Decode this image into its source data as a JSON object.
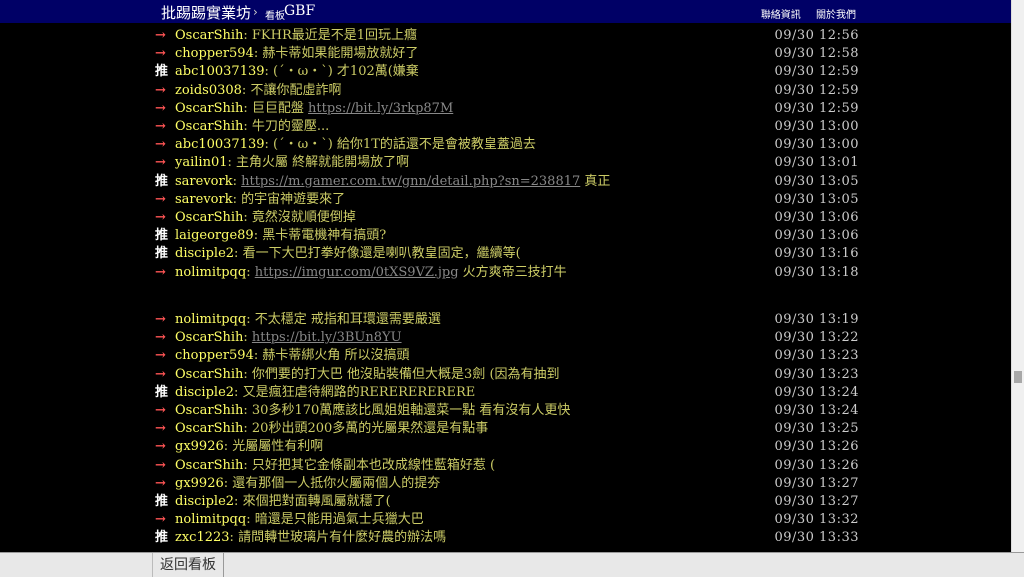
{
  "header": {
    "site_title": "批踢踢實業坊",
    "breadcrumb_sep": "›",
    "board_label": "看板",
    "board_name": "GBF",
    "links": [
      "聯絡資訊",
      "關於我們"
    ]
  },
  "comments_group1": [
    {
      "tag": "→",
      "user": "OscarShih",
      "text": "FKHR最近是不是1回玩上癮",
      "link": "",
      "after": "",
      "time": "09/30 12:56"
    },
    {
      "tag": "→",
      "user": "chopper594",
      "text": "赫卡蒂如果能開場放就好了",
      "link": "",
      "after": "",
      "time": "09/30 12:58"
    },
    {
      "tag": "推",
      "user": "abc10037139",
      "text": "(ˊ・ω・ˋ) 才102萬(嫌棄",
      "link": "",
      "after": "",
      "time": "09/30 12:59"
    },
    {
      "tag": "→",
      "user": "zoids0308",
      "text": "不讓你配虛詐啊",
      "link": "",
      "after": "",
      "time": "09/30 12:59"
    },
    {
      "tag": "→",
      "user": "OscarShih",
      "text": "巨巨配盤 ",
      "link": "https://bit.ly/3rkp87M",
      "after": "",
      "time": "09/30 12:59"
    },
    {
      "tag": "→",
      "user": "OscarShih",
      "text": "牛刀的靈壓...",
      "link": "",
      "after": "",
      "time": "09/30 13:00"
    },
    {
      "tag": "→",
      "user": "abc10037139",
      "text": "(ˊ・ω・ˋ) 給你1T的話還不是會被教皇蓋過去",
      "link": "",
      "after": "",
      "time": "09/30 13:00"
    },
    {
      "tag": "→",
      "user": "yailin01",
      "text": "主角火屬 終解就能開場放了啊",
      "link": "",
      "after": "",
      "time": "09/30 13:01"
    },
    {
      "tag": "推",
      "user": "sarevork",
      "text": "",
      "link": "https://m.gamer.com.tw/gnn/detail.php?sn=238817",
      "after": " 真正",
      "time": "09/30 13:05"
    },
    {
      "tag": "→",
      "user": "sarevork",
      "text": "的宇宙神遊要來了",
      "link": "",
      "after": "",
      "time": "09/30 13:05"
    },
    {
      "tag": "→",
      "user": "OscarShih",
      "text": "竟然沒就順便倒掉",
      "link": "",
      "after": "",
      "time": "09/30 13:06"
    },
    {
      "tag": "推",
      "user": "laigeorge89",
      "text": "黑卡蒂電機神有搞頭?",
      "link": "",
      "after": "",
      "time": "09/30 13:06"
    },
    {
      "tag": "推",
      "user": "disciple2",
      "text": "看一下大巴打拳好像還是喇叭教皇固定，繼續等(",
      "link": "",
      "after": "",
      "time": "09/30 13:16"
    },
    {
      "tag": "→",
      "user": "nolimitpqq",
      "text": "",
      "link": "https://imgur.com/0tXS9VZ.jpg",
      "after": " 火方爽帝三技打牛",
      "time": "09/30 13:18"
    }
  ],
  "comments_group2": [
    {
      "tag": "→",
      "user": "nolimitpqq",
      "text": "不太穩定 戒指和耳環還需要嚴選",
      "link": "",
      "after": "",
      "time": "09/30 13:19"
    },
    {
      "tag": "→",
      "user": "OscarShih",
      "text": "",
      "link": "https://bit.ly/3BUn8YU",
      "after": "",
      "time": "09/30 13:22"
    },
    {
      "tag": "→",
      "user": "chopper594",
      "text": "赫卡蒂綁火角  所以沒搞頭",
      "link": "",
      "after": "",
      "time": "09/30 13:23"
    },
    {
      "tag": "→",
      "user": "OscarShih",
      "text": "你們要的打大巴 他沒貼裝備但大概是3劍 (因為有抽到",
      "link": "",
      "after": "",
      "time": "09/30 13:23"
    },
    {
      "tag": "推",
      "user": "disciple2",
      "text": "又是瘋狂虐待網路的RERERERERERE",
      "link": "",
      "after": "",
      "time": "09/30 13:24"
    },
    {
      "tag": "→",
      "user": "OscarShih",
      "text": "30多秒170萬應該比風姐姐軸還菜一點 看有沒有人更快",
      "link": "",
      "after": "",
      "time": "09/30 13:24"
    },
    {
      "tag": "→",
      "user": "OscarShih",
      "text": "20秒出頭200多萬的光屬果然還是有點事",
      "link": "",
      "after": "",
      "time": "09/30 13:25"
    },
    {
      "tag": "→",
      "user": "gx9926",
      "text": "光屬屬性有利啊",
      "link": "",
      "after": "",
      "time": "09/30 13:26"
    },
    {
      "tag": "→",
      "user": "OscarShih",
      "text": "只好把其它金條副本也改成線性藍箱好惹 (",
      "link": "",
      "after": "",
      "time": "09/30 13:26"
    },
    {
      "tag": "→",
      "user": "gx9926",
      "text": "還有那個一人抵你火屬兩個人的提夯",
      "link": "",
      "after": "",
      "time": "09/30 13:27"
    },
    {
      "tag": "推",
      "user": "disciple2",
      "text": "來個把對面轉風屬就穩了(",
      "link": "",
      "after": "",
      "time": "09/30 13:27"
    },
    {
      "tag": "→",
      "user": "nolimitpqq",
      "text": "暗還是只能用過氣士兵獵大巴",
      "link": "",
      "after": "",
      "time": "09/30 13:32"
    },
    {
      "tag": "推",
      "user": "zxc1223",
      "text": "請問轉世玻璃片有什麼好農的辦法嗎",
      "link": "",
      "after": "",
      "time": "09/30 13:33"
    }
  ],
  "footer": {
    "back_label": "返回看板"
  },
  "colors": {
    "header_bg": "#000066",
    "arrow": "#ff5555",
    "user": "#ffff66",
    "text": "#cccc66"
  }
}
